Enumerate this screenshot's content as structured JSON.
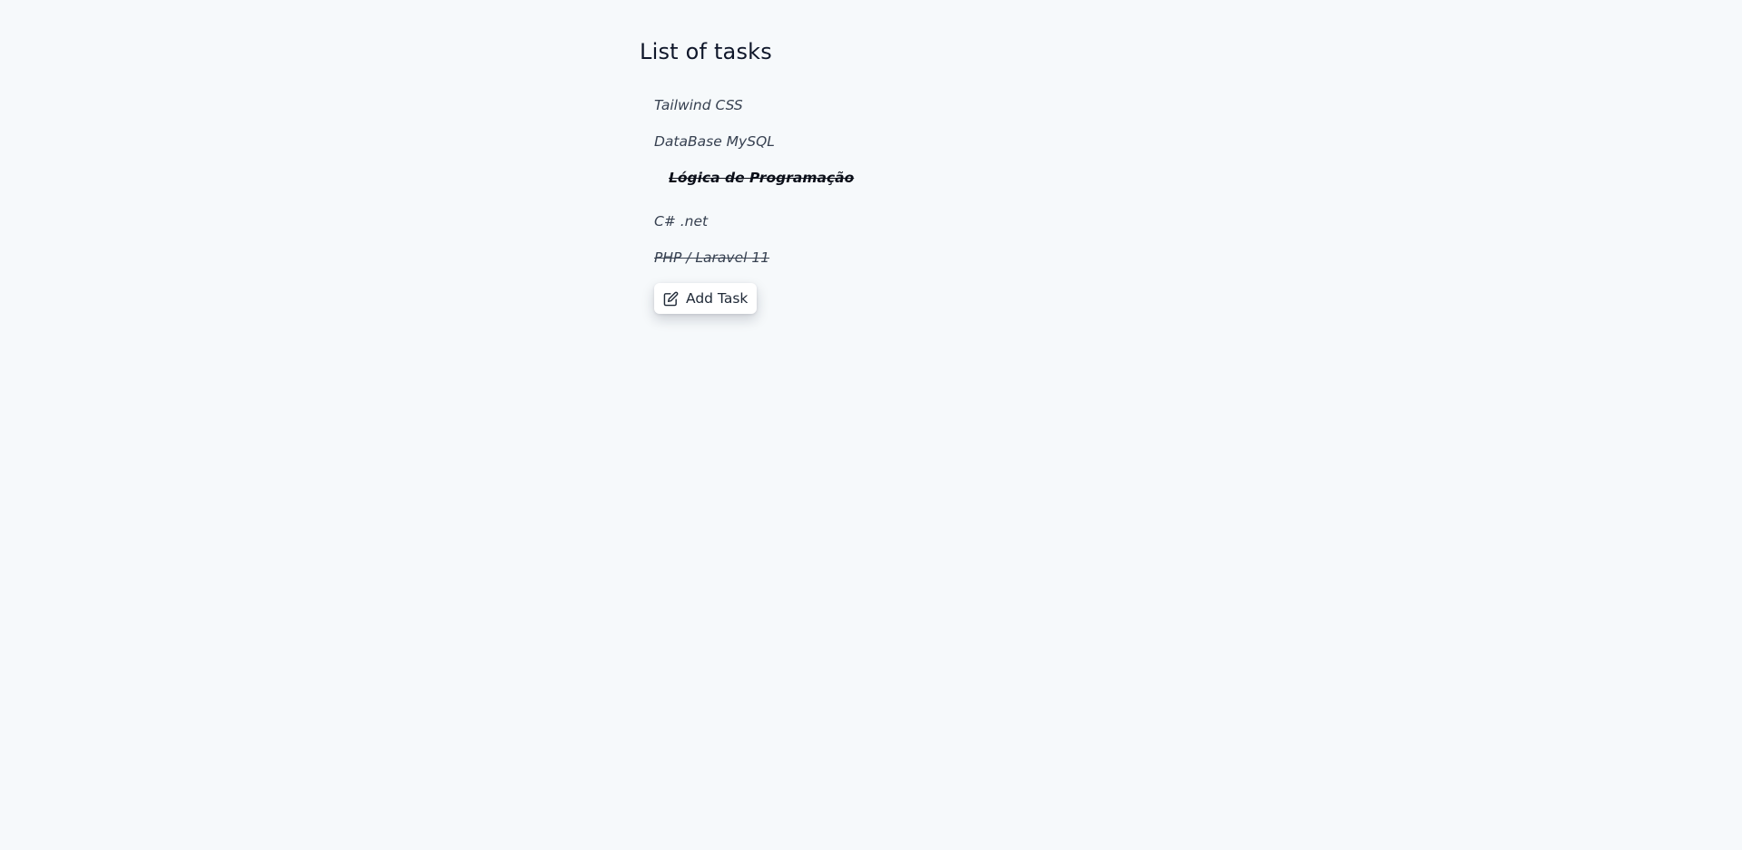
{
  "page": {
    "title": "List of tasks"
  },
  "tasks": [
    {
      "label": "Tailwind CSS",
      "done": false,
      "active": false
    },
    {
      "label": "DataBase MySQL",
      "done": false,
      "active": false
    },
    {
      "label": "Lógica de Programação",
      "done": true,
      "active": true
    },
    {
      "label": "C# .net",
      "done": false,
      "active": false
    },
    {
      "label": "PHP / Laravel 11",
      "done": true,
      "active": false
    }
  ],
  "actions": {
    "add_task_label": "Add Task",
    "add_task_icon": "edit-icon"
  }
}
